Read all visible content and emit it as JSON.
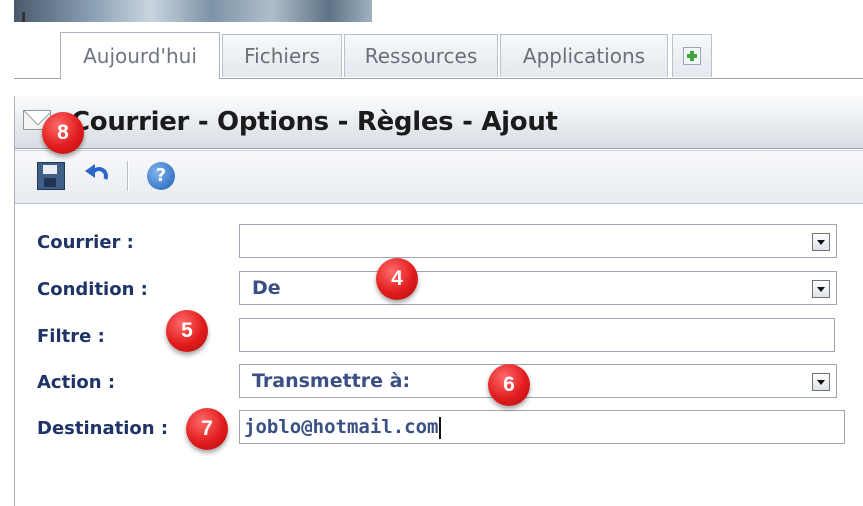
{
  "tabs": [
    {
      "label": "Aujourd'hui",
      "active": true
    },
    {
      "label": "Fichiers",
      "active": false
    },
    {
      "label": "Ressources",
      "active": false
    },
    {
      "label": "Applications",
      "active": false
    }
  ],
  "panel": {
    "title": "Courrier - Options - Règles - Ajout"
  },
  "toolbar": {
    "save": "save-icon",
    "undo": "undo-icon",
    "help": "help-icon",
    "help_glyph": "?"
  },
  "form": {
    "courrier_label": "Courrier :",
    "courrier_value": "",
    "condition_label": "Condition :",
    "condition_value": "De",
    "filtre_label": "Filtre :",
    "filtre_value": "",
    "action_label": "Action :",
    "action_value": "Transmettre à:",
    "destination_label": "Destination :",
    "destination_value": "joblo@hotmail.com"
  },
  "markers": {
    "m4": "4",
    "m5": "5",
    "m6": "6",
    "m7": "7",
    "m8": "8"
  },
  "colors": {
    "label_text": "#1f3466",
    "field_text": "#3a4f84",
    "marker_red": "#e11d1d",
    "add_tab_green": "#3fa33b"
  }
}
